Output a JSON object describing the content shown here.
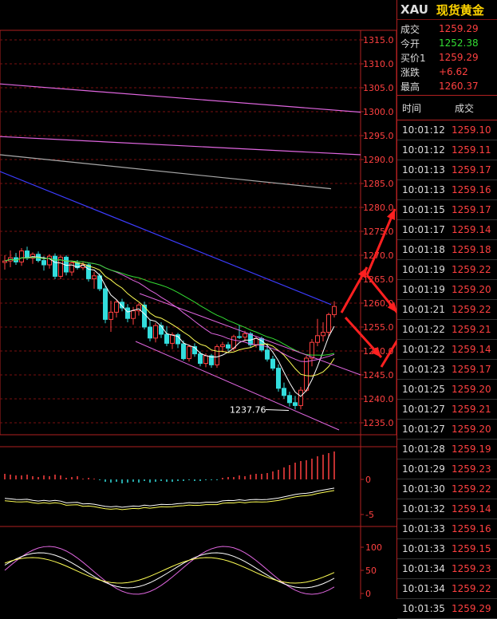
{
  "header": {
    "code": "XAU",
    "name": "现货黄金"
  },
  "quote": [
    {
      "label": "成交",
      "value": "1259.29",
      "color": "red"
    },
    {
      "label": "今开",
      "value": "1252.38",
      "color": "green"
    },
    {
      "label": "买价1",
      "value": "1259.29",
      "color": "red"
    },
    {
      "label": "涨跌",
      "value": "+6.62",
      "color": "red"
    },
    {
      "label": "最高",
      "value": "1260.37",
      "color": "red"
    }
  ],
  "ticks_header": {
    "time": "时间",
    "price": "成交"
  },
  "ticks": [
    {
      "time": "10:01:12",
      "price": "1259.10"
    },
    {
      "time": "10:01:12",
      "price": "1259.11"
    },
    {
      "time": "10:01:13",
      "price": "1259.17"
    },
    {
      "time": "10:01:13",
      "price": "1259.16"
    },
    {
      "time": "10:01:15",
      "price": "1259.17"
    },
    {
      "time": "10:01:17",
      "price": "1259.14"
    },
    {
      "time": "10:01:18",
      "price": "1259.18"
    },
    {
      "time": "10:01:19",
      "price": "1259.22"
    },
    {
      "time": "10:01:19",
      "price": "1259.20"
    },
    {
      "time": "10:01:21",
      "price": "1259.22"
    },
    {
      "time": "10:01:22",
      "price": "1259.21"
    },
    {
      "time": "10:01:22",
      "price": "1259.14"
    },
    {
      "time": "10:01:23",
      "price": "1259.17"
    },
    {
      "time": "10:01:25",
      "price": "1259.20"
    },
    {
      "time": "10:01:27",
      "price": "1259.21"
    },
    {
      "time": "10:01:27",
      "price": "1259.20"
    },
    {
      "time": "10:01:28",
      "price": "1259.19"
    },
    {
      "time": "10:01:29",
      "price": "1259.23"
    },
    {
      "time": "10:01:30",
      "price": "1259.22"
    },
    {
      "time": "10:01:32",
      "price": "1259.14"
    },
    {
      "time": "10:01:33",
      "price": "1259.16"
    },
    {
      "time": "10:01:33",
      "price": "1259.15"
    },
    {
      "time": "10:01:34",
      "price": "1259.23"
    },
    {
      "time": "10:01:34",
      "price": "1259.22"
    },
    {
      "time": "10:01:35",
      "price": "1259.29"
    }
  ],
  "chart_data": {
    "type": "candlestick",
    "price_axis": {
      "ticks": [
        "1315.0",
        "1310.0",
        "1305.0",
        "1300.0",
        "1295.0",
        "1290.0",
        "1285.0",
        "1280.0",
        "1275.0",
        "1270.0",
        "1265.0",
        "1260.0",
        "1255.0",
        "1250.0",
        "1245.0",
        "1240.0",
        "1235.0"
      ],
      "ylim": [
        1232.5,
        1317.0
      ]
    },
    "low_annotation": "1237.76",
    "candles": [
      [
        1268.5,
        1270.0,
        1267.0,
        1268.8
      ],
      [
        1268.8,
        1271.0,
        1267.5,
        1269.5
      ],
      [
        1269.5,
        1270.5,
        1268.0,
        1268.6
      ],
      [
        1268.6,
        1271.5,
        1267.8,
        1270.9
      ],
      [
        1270.9,
        1271.8,
        1269.0,
        1269.4
      ],
      [
        1269.4,
        1270.6,
        1268.2,
        1270.2
      ],
      [
        1270.2,
        1270.8,
        1268.5,
        1268.9
      ],
      [
        1268.9,
        1269.8,
        1266.8,
        1268.0
      ],
      [
        1268.0,
        1270.2,
        1267.2,
        1269.8
      ],
      [
        1269.8,
        1270.4,
        1265.0,
        1265.6
      ],
      [
        1265.6,
        1270.1,
        1265.0,
        1269.6
      ],
      [
        1269.6,
        1270.0,
        1265.8,
        1266.5
      ],
      [
        1266.5,
        1268.9,
        1265.7,
        1268.4
      ],
      [
        1268.4,
        1269.0,
        1267.0,
        1267.4
      ],
      [
        1267.4,
        1268.6,
        1266.9,
        1268.0
      ],
      [
        1268.0,
        1268.3,
        1264.5,
        1265.1
      ],
      [
        1265.1,
        1266.5,
        1263.0,
        1265.7
      ],
      [
        1265.7,
        1266.2,
        1262.5,
        1263.0
      ],
      [
        1263.0,
        1263.6,
        1255.8,
        1256.6
      ],
      [
        1256.6,
        1260.5,
        1254.0,
        1258.1
      ],
      [
        1258.1,
        1260.8,
        1257.0,
        1260.2
      ],
      [
        1260.2,
        1260.9,
        1258.3,
        1259.0
      ],
      [
        1259.0,
        1259.8,
        1256.0,
        1256.8
      ],
      [
        1256.8,
        1259.2,
        1255.5,
        1258.4
      ],
      [
        1258.4,
        1260.0,
        1257.4,
        1259.6
      ],
      [
        1259.6,
        1260.3,
        1254.5,
        1255.0
      ],
      [
        1255.0,
        1256.6,
        1252.0,
        1252.7
      ],
      [
        1252.7,
        1255.9,
        1251.8,
        1255.3
      ],
      [
        1255.3,
        1256.0,
        1252.7,
        1253.5
      ],
      [
        1253.5,
        1255.2,
        1251.0,
        1251.6
      ],
      [
        1251.6,
        1253.9,
        1250.4,
        1253.4
      ],
      [
        1253.4,
        1253.8,
        1250.6,
        1251.5
      ],
      [
        1251.5,
        1252.2,
        1248.0,
        1248.4
      ],
      [
        1248.4,
        1251.4,
        1247.8,
        1250.9
      ],
      [
        1250.9,
        1251.6,
        1248.8,
        1249.4
      ],
      [
        1249.4,
        1249.9,
        1246.8,
        1247.4
      ],
      [
        1247.4,
        1249.5,
        1246.6,
        1249.0
      ],
      [
        1249.0,
        1249.4,
        1246.5,
        1247.1
      ],
      [
        1247.1,
        1251.4,
        1246.5,
        1250.9
      ],
      [
        1250.9,
        1251.9,
        1249.7,
        1251.3
      ],
      [
        1251.3,
        1251.9,
        1250.0,
        1250.6
      ],
      [
        1250.6,
        1253.4,
        1250.0,
        1253.0
      ],
      [
        1253.0,
        1255.4,
        1252.5,
        1252.9
      ],
      [
        1252.9,
        1254.2,
        1252.0,
        1253.6
      ],
      [
        1253.6,
        1254.0,
        1250.8,
        1251.3
      ],
      [
        1251.3,
        1253.0,
        1250.7,
        1252.6
      ],
      [
        1252.6,
        1253.0,
        1249.8,
        1250.2
      ],
      [
        1250.2,
        1251.5,
        1247.8,
        1248.3
      ],
      [
        1248.3,
        1249.0,
        1245.9,
        1246.4
      ],
      [
        1246.4,
        1247.2,
        1241.5,
        1242.2
      ],
      [
        1242.2,
        1243.4,
        1240.0,
        1240.7
      ],
      [
        1240.7,
        1241.5,
        1238.4,
        1239.2
      ],
      [
        1239.2,
        1240.6,
        1237.8,
        1238.6
      ],
      [
        1238.6,
        1242.5,
        1237.8,
        1241.8
      ],
      [
        1241.8,
        1249.0,
        1241.4,
        1248.5
      ],
      [
        1248.5,
        1252.5,
        1246.8,
        1251.8
      ],
      [
        1251.8,
        1256.7,
        1251.0,
        1253.2
      ],
      [
        1253.2,
        1256.0,
        1252.0,
        1253.9
      ],
      [
        1253.9,
        1258.0,
        1253.0,
        1257.6
      ],
      [
        1257.6,
        1260.4,
        1257.0,
        1259.3
      ]
    ],
    "ma_lines": [
      {
        "color": "#e066e0",
        "values": [
          1305.8,
          1299.9
        ]
      },
      {
        "color": "#e066e0",
        "values": [
          1294.8,
          1291.0
        ]
      },
      {
        "color": "#aaaaaa",
        "values": [
          1291.0,
          1283.9
        ]
      },
      {
        "color": "#3c3cff",
        "values": [
          1287.5,
          1259.7
        ]
      }
    ],
    "macd": {
      "axis_ticks": [
        "0",
        "-5"
      ],
      "hist": [
        0.7,
        0.6,
        0.5,
        0.5,
        0.6,
        0.4,
        0.3,
        0.5,
        0.4,
        0.6,
        0.5,
        0.2,
        0.3,
        0.4,
        0.1,
        0.2,
        0.1,
        -0.1,
        -0.3,
        -0.4,
        -0.3,
        -0.5,
        -0.4,
        -0.3,
        -0.4,
        -0.2,
        -0.4,
        -0.3,
        -0.2,
        -0.3,
        -0.3,
        -0.2,
        -0.2,
        -0.1,
        -0.2,
        -0.2,
        -0.1,
        -0.1,
        -0.1,
        0.2,
        0.3,
        0.3,
        0.5,
        0.4,
        0.6,
        0.7,
        0.7,
        0.8,
        1.0,
        1.2,
        1.5,
        1.8,
        2.1,
        2.3,
        2.4,
        2.6,
        2.9,
        3.1,
        3.3,
        3.5
      ]
    },
    "kdj": {
      "axis_ticks": [
        "100",
        "50",
        "0"
      ]
    }
  }
}
